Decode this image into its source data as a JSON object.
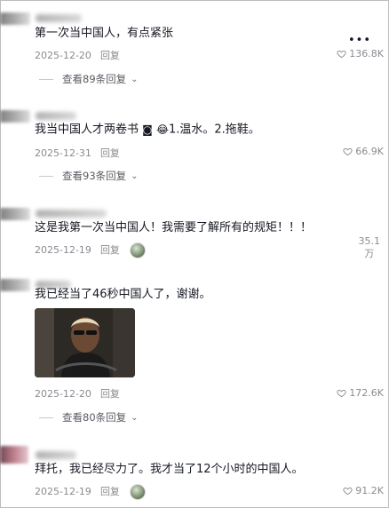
{
  "comments": [
    {
      "text": "第一次当中国人，有点紧张",
      "date": "2025-12-20",
      "reply": "回复",
      "likes": "136.8K",
      "more": "•••",
      "view_replies": "查看89条回复"
    },
    {
      "text": "我当中国人才两卷书",
      "text_tail": "1.温水。2.拖鞋。",
      "emoji_a": "◙",
      "emoji_b": "😂",
      "date": "2025-12-31",
      "reply": "回复",
      "likes": "66.9K",
      "view_replies": "查看93条回复"
    },
    {
      "text": "这是我第一次当中国人！我需要了解所有的规矩！！！",
      "date": "2025-12-19",
      "reply": "回复",
      "likes_top": "35.1",
      "likes_bottom": "万"
    },
    {
      "text": "我已经当了46秒中国人了，谢谢。",
      "date": "2025-12-20",
      "reply": "回复",
      "likes": "172.6K",
      "view_replies": "查看80条回复"
    },
    {
      "text": "拜托，我已经尽力了。我才当了12个小时的中国人。",
      "date": "2025-12-19",
      "reply": "回复",
      "likes": "91.2K"
    }
  ],
  "icons": {
    "like": "heart-outline-icon",
    "chevron": "chevron-down-icon",
    "more": "more-dots-icon"
  },
  "colors": {
    "text": "#161823",
    "meta": "#8a8b91",
    "background": "#ffffff"
  }
}
